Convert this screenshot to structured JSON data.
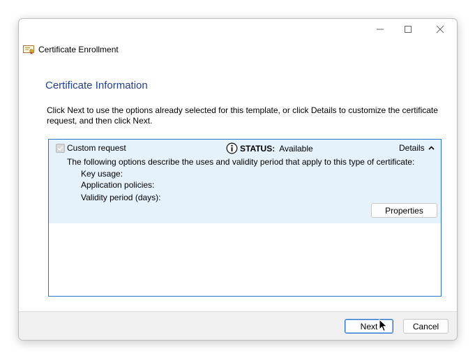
{
  "window": {
    "title": "Certificate Enrollment",
    "controls": {
      "minimize": "minimize",
      "maximize": "maximize",
      "close": "close"
    }
  },
  "page": {
    "heading": "Certificate Information",
    "description": "Click Next to use the options already selected for this template, or click Details to customize the certificate request, and then click Next."
  },
  "request": {
    "label": "Custom request",
    "checked": true,
    "status_key": "STATUS:",
    "status_value": "Available",
    "details_label": "Details",
    "options_description": "The following options describe the uses and validity period that apply to this type of certificate:",
    "fields": [
      {
        "label": "Key usage:"
      },
      {
        "label": "Application policies:"
      },
      {
        "label": "Validity period (days):"
      }
    ],
    "properties_button": "Properties"
  },
  "footer": {
    "next_button": "Next",
    "cancel_button": "Cancel"
  },
  "colors": {
    "heading": "#1f3f8f",
    "selection": "#e5f1fb",
    "accent_border": "#2b73c8"
  },
  "icons": [
    "certificate-icon",
    "info-icon",
    "chevron-up-icon",
    "checkmark-icon",
    "mouse-cursor-icon"
  ]
}
